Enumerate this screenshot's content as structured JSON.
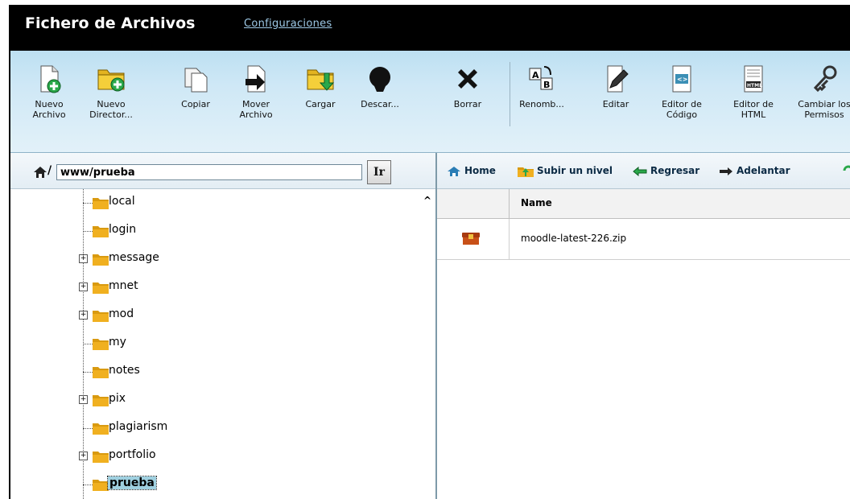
{
  "app": {
    "title": "Fichero de Archivos",
    "config_link": "Configuraciones"
  },
  "toolbar": {
    "new_file": "Nuevo Archivo",
    "new_dir": "Nuevo Director...",
    "copy": "Copiar",
    "move": "Mover Archivo",
    "upload": "Cargar",
    "download": "Descar...",
    "delete": "Borrar",
    "rename": "Renomb...",
    "edit": "Editar",
    "code_editor": "Editor de Código",
    "html_editor": "Editor de HTML",
    "permissions": "Cambiar los Permisos"
  },
  "tree": {
    "path": "www/prueba",
    "slash": "/",
    "go_label": "Ir",
    "items": [
      {
        "label": "local"
      },
      {
        "label": "login"
      },
      {
        "label": "message"
      },
      {
        "label": "mnet"
      },
      {
        "label": "mod"
      },
      {
        "label": "my"
      },
      {
        "label": "notes"
      },
      {
        "label": "pix"
      },
      {
        "label": "plagiarism"
      },
      {
        "label": "portfolio"
      },
      {
        "label": "prueba"
      }
    ]
  },
  "nav": {
    "home": "Home",
    "up": "Subir un nivel",
    "back": "Regresar",
    "forward": "Adelantar"
  },
  "files": {
    "col_name": "Name",
    "rows": [
      {
        "name": "moodle-latest-226.zip"
      }
    ]
  },
  "colors": {
    "titlebar": "#000000",
    "toolbar": "#cfe8f6",
    "selection": "#9fd0e0",
    "folder": "#f0b020"
  }
}
